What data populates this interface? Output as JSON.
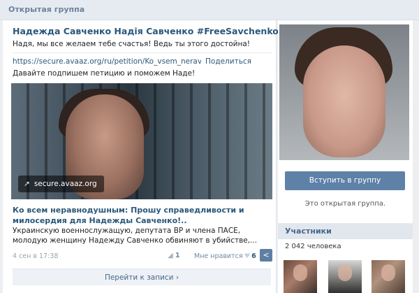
{
  "topbar": {
    "label": "Открытая группа"
  },
  "group": {
    "name": "Надежда Савченко Надія Савченко #FreeSavchenko",
    "status": "Надя, мы все желаем тебе счастья! Ведь ты этого достойна!"
  },
  "post": {
    "link_url": "https://secure.avaaz.org/ru/petition/Ko_vsem_neravnod",
    "share_label": "Поделиться",
    "text": "Давайте подпишем петицию и поможем Наде!",
    "image_source": "secure.avaaz.org",
    "link_title": "Ко всем неравнодушным: Прошу справедливости и милосердия для Надежды Савченко!..",
    "link_snippet": "Украинскую военнослужащую, депутата ВР и члена ПАСЕ, молодую женщину Надежду Савченко обвиняют в убийстве,...",
    "date": "4 сен в 17:38",
    "reposts": "1",
    "like_label": "Мне нравится",
    "likes": "6",
    "goto_label": "Перейти к записи"
  },
  "sidebar": {
    "join_label": "Вступить в группу",
    "open_text": "Это открытая группа.",
    "members_title": "Участники",
    "members_count": "2 042 человека"
  },
  "icons": {
    "link_arrow": "arrow-icon",
    "repost": "megaphone-icon",
    "like": "heart-icon",
    "share": "share-icon",
    "chevron": "chevron-right-icon"
  },
  "colors": {
    "link": "#2b587a",
    "button": "#5e81a8",
    "page_bg": "#edeef0"
  }
}
